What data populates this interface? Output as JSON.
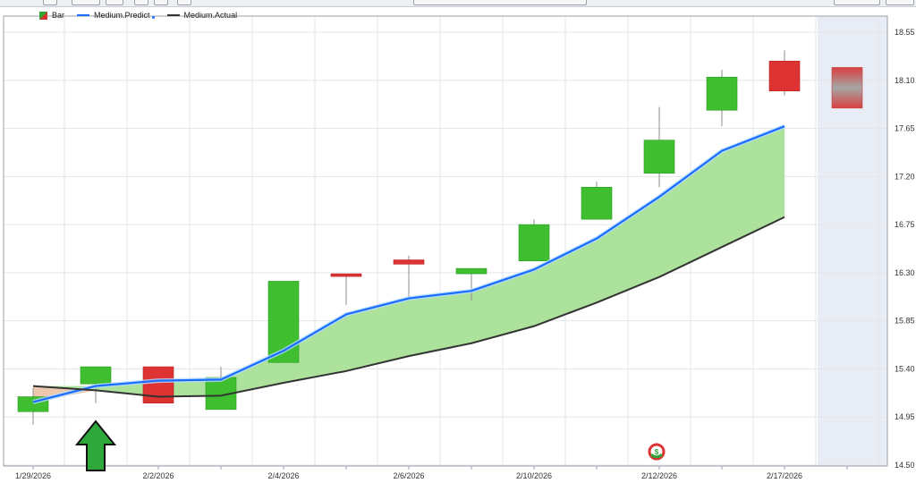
{
  "toolbar": {
    "range_text": ""
  },
  "legend": [
    {
      "label": "Bar",
      "kind": "bar"
    },
    {
      "label": "Medium.Predict",
      "kind": "line",
      "color": "#1a6cff"
    },
    {
      "label": "Medium.Actual",
      "kind": "line",
      "color": "#333333"
    }
  ],
  "chart_data": {
    "type": "candlestick",
    "title": "",
    "xlabel": "",
    "ylabel": "",
    "ylim": [
      14.5,
      18.7
    ],
    "y_ticks": [
      14.5,
      14.95,
      15.4,
      15.85,
      16.3,
      16.75,
      17.2,
      17.65,
      18.1,
      18.55
    ],
    "x_tick_labels": [
      "1/29/2026",
      "2/2/2026",
      "2/4/2026",
      "2/6/2026",
      "2/10/2026",
      "2/12/2026",
      "2/17/2026"
    ],
    "x_tick_label_index": [
      0,
      2,
      4,
      6,
      8,
      10,
      12
    ],
    "grid": true,
    "forecast_region": true,
    "colors": {
      "up": "#3fbf2f",
      "down": "#dd3333",
      "predict": "#1a6cff",
      "actual": "#333333",
      "fill": "#a8e096"
    },
    "candles": [
      {
        "date": "1/29/2026",
        "open": 15.0,
        "high": 15.22,
        "low": 14.88,
        "close": 15.14
      },
      {
        "date": "1/30/2026",
        "open": 15.26,
        "high": 15.42,
        "low": 15.08,
        "close": 15.42
      },
      {
        "date": "2/2/2026",
        "open": 15.42,
        "high": 15.42,
        "low": 15.08,
        "close": 15.08
      },
      {
        "date": "2/3/2026",
        "open": 15.02,
        "high": 15.42,
        "low": 15.02,
        "close": 15.32
      },
      {
        "date": "2/4/2026",
        "open": 15.46,
        "high": 16.22,
        "low": 15.46,
        "close": 16.22
      },
      {
        "date": "2/5/2026",
        "open": 16.29,
        "high": 16.29,
        "low": 16.0,
        "close": 16.27
      },
      {
        "date": "2/6/2026",
        "open": 16.42,
        "high": 16.46,
        "low": 16.06,
        "close": 16.38
      },
      {
        "date": "2/9/2026",
        "open": 16.29,
        "high": 16.34,
        "low": 16.04,
        "close": 16.34
      },
      {
        "date": "2/10/2026",
        "open": 16.41,
        "high": 16.8,
        "low": 16.41,
        "close": 16.75
      },
      {
        "date": "2/11/2026",
        "open": 16.8,
        "high": 17.15,
        "low": 16.8,
        "close": 17.1
      },
      {
        "date": "2/12/2026",
        "open": 17.23,
        "high": 17.85,
        "low": 17.1,
        "close": 17.54
      },
      {
        "date": "2/13/2026",
        "open": 17.82,
        "high": 18.2,
        "low": 17.67,
        "close": 18.13
      },
      {
        "date": "2/17/2026",
        "open": 18.28,
        "high": 18.38,
        "low": 17.96,
        "close": 18.0
      }
    ],
    "forecast_candle": {
      "open": 18.22,
      "close": 17.84
    },
    "series": [
      {
        "name": "Medium.Predict",
        "values": [
          15.09,
          15.24,
          15.29,
          15.3,
          15.57,
          15.91,
          16.06,
          16.13,
          16.33,
          16.62,
          17.01,
          17.44,
          17.67
        ]
      },
      {
        "name": "Medium.Actual",
        "values": [
          15.24,
          15.2,
          15.14,
          15.15,
          15.27,
          15.38,
          15.52,
          15.64,
          15.8,
          16.02,
          16.26,
          16.54,
          16.82
        ]
      }
    ],
    "annotations": {
      "arrow_under_index": 1,
      "dollar_badge_under_index": 10
    }
  }
}
